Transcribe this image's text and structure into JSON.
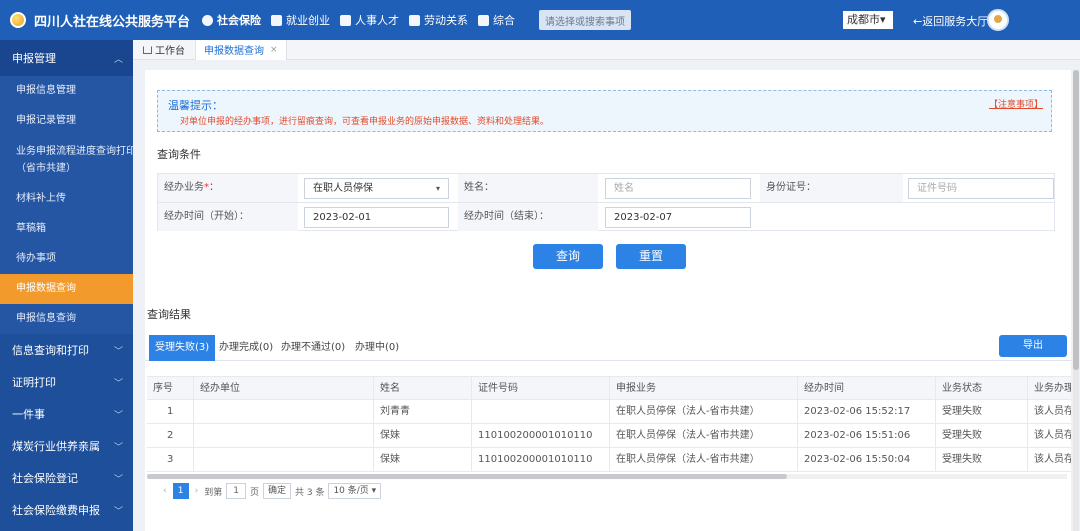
{
  "header": {
    "title": "四川人社在线公共服务平台",
    "nav": [
      {
        "label": "社会保险",
        "icon": "umbrella-icon"
      },
      {
        "label": "就业创业",
        "icon": "briefcase-icon"
      },
      {
        "label": "人事人才",
        "icon": "people-icon"
      },
      {
        "label": "劳动关系",
        "icon": "document-icon"
      },
      {
        "label": "综合",
        "icon": "layers-icon"
      }
    ],
    "search_placeholder": "请选择或搜索事项",
    "city": "成都市▾",
    "back_label": "←返回服务大厅"
  },
  "sidebar": {
    "group_main": "申报管理",
    "items": [
      {
        "label": "申报信息管理"
      },
      {
        "label": "申报记录管理"
      },
      {
        "label": "业务申报流程进度查询打印",
        "label2": "（省市共建）"
      },
      {
        "label": "材料补上传"
      },
      {
        "label": "草稿箱"
      },
      {
        "label": "待办事项"
      },
      {
        "label": "申报数据查询"
      },
      {
        "label": "申报信息查询"
      }
    ],
    "groups": [
      {
        "label": "信息查询和打印"
      },
      {
        "label": "证明打印"
      },
      {
        "label": "一件事"
      },
      {
        "label": "煤炭行业供养亲属"
      },
      {
        "label": "社会保险登记"
      },
      {
        "label": "社会保险缴费申报"
      }
    ]
  },
  "tabs": {
    "home": "工作台",
    "current": "申报数据查询",
    "close": "×"
  },
  "tip": {
    "title": "温馨提示：",
    "text": "对单位申报的经办事项，进行留痕查询，可查看申报业务的原始申报数据、资料和处理结果。",
    "link": "【注意事项】"
  },
  "query": {
    "title": "查询条件",
    "business_label": "经办业务",
    "required_mark": "*",
    "colon": "：",
    "business_value": "在职人员停保",
    "caret": "▾",
    "name_label": "姓名：",
    "name_placeholder": "姓名",
    "id_label": "身份证号：",
    "id_placeholder": "证件号码",
    "start_label": "经办时间（开始）：",
    "start_value": "2023-02-01",
    "end_label": "经办时间（结束）：",
    "end_value": "2023-02-07",
    "search_btn": "查询",
    "reset_btn": "重置"
  },
  "results": {
    "title": "查询结果",
    "tabs": [
      {
        "label": "受理失败(3)",
        "active": true
      },
      {
        "label": "办理完成(0)"
      },
      {
        "label": "办理不通过(0)"
      },
      {
        "label": "办理中(0)"
      }
    ],
    "export_label": "导出",
    "columns": [
      "序号",
      "经办单位",
      "姓名",
      "证件号码",
      "申报业务",
      "经办时间",
      "业务状态",
      "业务办理"
    ],
    "rows": [
      [
        "1",
        "",
        "刘青青",
        "",
        "在职人员停保（法人-省市共建）",
        "2023-02-06 15:52:17",
        "受理失败",
        "该人员存"
      ],
      [
        "2",
        "",
        "保妹",
        "110100200001010110",
        "在职人员停保（法人-省市共建）",
        "2023-02-06 15:51:06",
        "受理失败",
        "该人员存"
      ],
      [
        "3",
        "",
        "保妹",
        "110100200001010110",
        "在职人员停保（法人-省市共建）",
        "2023-02-06 15:50:04",
        "受理失败",
        "该人员存"
      ]
    ]
  },
  "pager": {
    "prev": "‹",
    "current": "1",
    "next": "›",
    "goto_label": "到第",
    "goto_value": "1",
    "page_unit": "页",
    "confirm": "确定",
    "total": "共 3 条",
    "per_page": "10 条/页 ▾"
  }
}
